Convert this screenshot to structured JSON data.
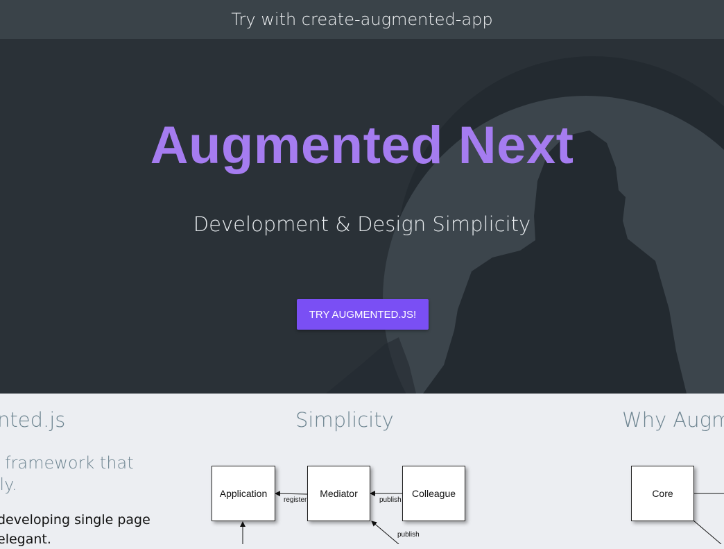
{
  "topbar": {
    "text": "Try with create-augmented-app"
  },
  "hero": {
    "title": "Augmented Next",
    "subtitle": "Development & Design Simplicity",
    "cta_label": "TRY AUGMENTED.JS!"
  },
  "features": {
    "col1": {
      "title": "nted.js",
      "lead": "t framework that\ntly.",
      "body": "developing single page\nelegant."
    },
    "col2": {
      "title": "Simplicity",
      "diagram": {
        "boxes": [
          "Application",
          "Mediator",
          "Colleague"
        ],
        "labels": [
          "register",
          "publish",
          "publish"
        ]
      }
    },
    "col3": {
      "title": "Why Augme",
      "diagram": {
        "boxes": [
          "Core"
        ]
      }
    }
  },
  "colors": {
    "topbar": "#3a4349",
    "hero_bg": "#2a3137",
    "title_purple": "#a57cf0",
    "button": "#7a4ff4",
    "section_bg": "#eceef2",
    "heading_gray": "#6e8591"
  }
}
